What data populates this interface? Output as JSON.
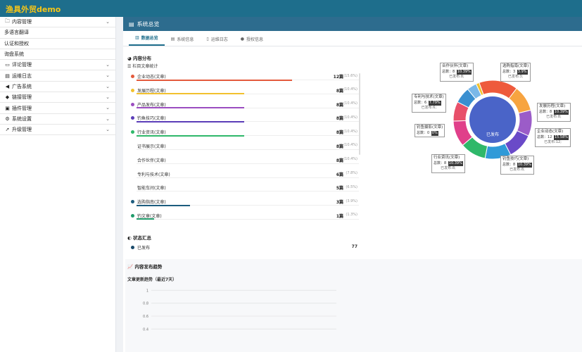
{
  "brand": "渔具外贸demo",
  "sidebar": {
    "items": [
      {
        "label": "内容管理",
        "icon": "folder-icon",
        "glyph": "🗀",
        "chevron": true
      },
      {
        "label": "多语言翻译",
        "icon": "",
        "glyph": "",
        "chevron": false
      },
      {
        "label": "认证和授权",
        "icon": "",
        "glyph": "",
        "chevron": false
      },
      {
        "label": "询盘系统",
        "icon": "",
        "glyph": "",
        "chevron": false
      },
      {
        "label": "评论管理",
        "icon": "comment-icon",
        "glyph": "▭",
        "chevron": true
      },
      {
        "label": "运维日志",
        "icon": "log-icon",
        "glyph": "▤",
        "chevron": true
      },
      {
        "label": "广告系统",
        "icon": "megaphone-icon",
        "glyph": "◀",
        "chevron": true
      },
      {
        "label": "链接管理",
        "icon": "link-icon",
        "glyph": "◆",
        "chevron": true
      },
      {
        "label": "插件管理",
        "icon": "plugin-icon",
        "glyph": "▣",
        "chevron": true
      },
      {
        "label": "系统设置",
        "icon": "gear-icon",
        "glyph": "⚙",
        "chevron": true
      },
      {
        "label": "升级管理",
        "icon": "rocket-icon",
        "glyph": "➚",
        "chevron": true
      }
    ]
  },
  "main": {
    "title": "系统总览",
    "tabs": [
      {
        "label": "数据总览",
        "icon": "chart-icon",
        "glyph": "▥",
        "active": true
      },
      {
        "label": "系统信息",
        "icon": "server-icon",
        "glyph": "▤",
        "active": false
      },
      {
        "label": "运维日志",
        "icon": "file-icon",
        "glyph": "▯",
        "active": false
      },
      {
        "label": "授权信息",
        "icon": "shield-icon",
        "glyph": "●",
        "active": false
      }
    ]
  },
  "content_dist": {
    "title": "内容分布",
    "subtitle": "栏目文章统计",
    "rows": [
      {
        "name": "企业动态(文章)",
        "value": "12篇",
        "pct": "(15.6%)",
        "fraction": 0.7,
        "color": "#e45a3c",
        "dot": true
      },
      {
        "name": "发展历程(文章)",
        "value": "8篇",
        "pct": "(10.4%)",
        "fraction": 0.485,
        "color": "#f2c12e",
        "dot": true
      },
      {
        "name": "产品发布(文章)",
        "value": "8篇",
        "pct": "(10.4%)",
        "fraction": 0.485,
        "color": "#9b4dc0",
        "dot": true
      },
      {
        "name": "钓鱼技巧(文章)",
        "value": "8篇",
        "pct": "(10.4%)",
        "fraction": 0.485,
        "color": "#5b3db8",
        "dot": true
      },
      {
        "name": "行业资讯(文章)",
        "value": "8篇",
        "pct": "(10.4%)",
        "fraction": 0.485,
        "color": "#2fb86a",
        "dot": true
      },
      {
        "name": "证书展示(文章)",
        "value": "8篇",
        "pct": "(10.4%)",
        "fraction": 0,
        "color": "#999999",
        "dot": false
      },
      {
        "name": "合作伙伴(文章)",
        "value": "8篇",
        "pct": "(10.4%)",
        "fraction": 0,
        "color": "#999999",
        "dot": false
      },
      {
        "name": "专利与技术(文章)",
        "value": "6篇",
        "pct": "(7.8%)",
        "fraction": 0,
        "color": "#999999",
        "dot": false
      },
      {
        "name": "智能车间(文章)",
        "value": "5篇",
        "pct": "(6.5%)",
        "fraction": 0,
        "color": "#999999",
        "dot": false
      },
      {
        "name": "选购指南(文章)",
        "value": "3篇",
        "pct": "(3.9%)",
        "fraction": 0.24,
        "color": "#1c5c7e",
        "dot": true
      },
      {
        "name": "钓文章(文章)",
        "value": "1篇",
        "pct": "(1.3%)",
        "fraction": 0.08,
        "color": "#1f9a6a",
        "dot": true
      }
    ]
  },
  "status": {
    "title": "状态汇总",
    "rows": [
      {
        "name": "已发布",
        "value": "77"
      }
    ]
  },
  "trend": {
    "title": "内容发布趋势",
    "subtitle": "文章更新趋势（最近7天）"
  },
  "chart_data": [
    {
      "type": "pie",
      "inner_label": "已发布",
      "categories": [
        "企业动态(文章)",
        "发展历程(文章)",
        "产品发布(文章)",
        "钓鱼技巧(文章)",
        "行业资讯(文章)",
        "证书展示(文章)",
        "合作伙伴(文章)",
        "专利与技术(文章)",
        "智能车间(文章)",
        "选购指南(文章)",
        "钓文章(文章)"
      ],
      "values": [
        12,
        8,
        8,
        8,
        8,
        8,
        8,
        6,
        5,
        3,
        1
      ],
      "colors": [
        "#ee5a3c",
        "#f7a440",
        "#9b5cc8",
        "#6a4ac8",
        "#2f9ad8",
        "#2fb86a",
        "#e0408a",
        "#e8506a",
        "#3a8fd0",
        "#7ab8e8",
        "#f2c12e"
      ],
      "inner_color": "#4a64c8",
      "callouts": [
        {
          "title": "合作伙伴(文章)",
          "count_label": "总数：",
          "count": "8",
          "percent": "10.39%",
          "sub": "已发布:8;"
        },
        {
          "title": "选购指南(文章)",
          "count_label": "总数：",
          "count": "3",
          "percent": "3.9%",
          "sub": "已发布:3;"
        },
        {
          "title": "专利与技术(文章)",
          "count_label": "总数：",
          "count": "6",
          "percent": "7.79%",
          "sub": "已发布:6;"
        },
        {
          "title": "发展历程(文章)",
          "count_label": "总数：",
          "count": "8",
          "percent": "10.39%",
          "sub": "已发布:8;"
        },
        {
          "title": "钓鱼摄影(文章)",
          "count_label": "总数：",
          "count": "0",
          "percent": "0%",
          "sub": ""
        },
        {
          "title": "企业动态(文章)",
          "count_label": "总数：",
          "count": "12",
          "percent": "15.58%",
          "sub": "已发布:12;"
        },
        {
          "title": "行业资讯(文章)",
          "count_label": "总数：",
          "count": "8",
          "percent": "10.39%",
          "sub": "已发布:8;"
        },
        {
          "title": "钓鱼技巧(文章)",
          "count_label": "总数：",
          "count": "8",
          "percent": "10.39%",
          "sub": "已发布:8;"
        }
      ]
    },
    {
      "type": "line",
      "title": "文章更新趋势（最近7天）",
      "yticks": [
        "1",
        "0.8",
        "0.6",
        "0.4"
      ],
      "ylim": [
        0,
        1.2
      ],
      "grid": true
    }
  ]
}
